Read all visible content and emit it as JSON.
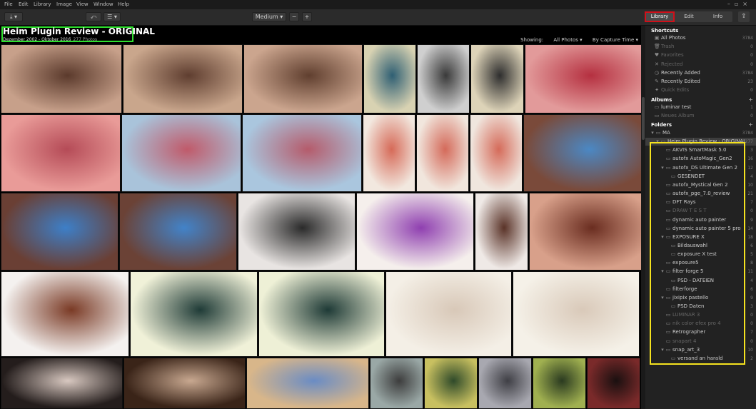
{
  "menu": [
    "File",
    "Edit",
    "Library",
    "Image",
    "View",
    "Window",
    "Help"
  ],
  "window_controls": [
    "–",
    "▫",
    "×"
  ],
  "toolbar": {
    "import_icon": "download-icon",
    "zoom_value": "Medium",
    "zoom_out": "−",
    "zoom_in": "+",
    "tabs": [
      "Library",
      "Edit",
      "Info"
    ],
    "active_tab": "Library",
    "share_icon": "share-icon"
  },
  "album": {
    "title": "Heim Plugin Review - ORIGINAL",
    "date_range": "Dezember 2002 - Oktober 2016",
    "photo_count": "277 Photos",
    "showing_label": "Showing:",
    "filter": "All Photos",
    "sort": "By Capture Time"
  },
  "thumbnails": [
    {
      "row": 0,
      "colors": [
        "#c7a08a",
        "#5b3a2c"
      ]
    },
    {
      "row": 0,
      "colors": [
        "#c9a68c",
        "#5f3e30"
      ]
    },
    {
      "row": 0,
      "colors": [
        "#cba58e",
        "#603f2f"
      ]
    },
    {
      "row": 0,
      "colors": [
        "#d8d2b2",
        "#2f5f73"
      ]
    },
    {
      "row": 0,
      "colors": [
        "#cfcfcf",
        "#3a3a3a"
      ]
    },
    {
      "row": 0,
      "colors": [
        "#ddd3b8",
        "#2e2e2e"
      ]
    },
    {
      "row": 0,
      "colors": [
        "#e29a9a",
        "#b53040"
      ]
    },
    {
      "row": 1,
      "colors": [
        "#e99b98",
        "#b54b57"
      ]
    },
    {
      "row": 1,
      "colors": [
        "#a9c3da",
        "#c05a6a"
      ]
    },
    {
      "row": 1,
      "colors": [
        "#aac6de",
        "#b55b6b"
      ]
    },
    {
      "row": 1,
      "colors": [
        "#f2e8df",
        "#d66a58"
      ]
    },
    {
      "row": 1,
      "colors": [
        "#f1e6dd",
        "#d46a5a"
      ]
    },
    {
      "row": 1,
      "colors": [
        "#f0e6de",
        "#d56b5a"
      ]
    },
    {
      "row": 1,
      "colors": [
        "#7a4a3a",
        "#4b88c4"
      ]
    },
    {
      "row": 2,
      "colors": [
        "#6a3f34",
        "#3d7fc8"
      ]
    },
    {
      "row": 2,
      "colors": [
        "#6b4236",
        "#4283c9"
      ]
    },
    {
      "row": 2,
      "colors": [
        "#e8e4e2",
        "#2a2a2a"
      ]
    },
    {
      "row": 2,
      "colors": [
        "#f5efec",
        "#8f3fb0"
      ]
    },
    {
      "row": 2,
      "colors": [
        "#efe9e6",
        "#5a3328"
      ]
    },
    {
      "row": 2,
      "colors": [
        "#d8a08a",
        "#6a2d20"
      ]
    },
    {
      "row": 3,
      "colors": [
        "#f4f1ef",
        "#7a3a25"
      ]
    },
    {
      "row": 3,
      "colors": [
        "#f0f1d8",
        "#1f3b37"
      ]
    },
    {
      "row": 3,
      "colors": [
        "#eef0d6",
        "#1e3a36"
      ]
    },
    {
      "row": 3,
      "colors": [
        "#f4efe6",
        "#d8c8b8"
      ]
    },
    {
      "row": 3,
      "colors": [
        "#f5f1e8",
        "#d9c9b9"
      ]
    },
    {
      "row": 4,
      "colors": [
        "#241d1c",
        "#d8c8c0"
      ]
    },
    {
      "row": 4,
      "colors": [
        "#3a2418",
        "#c8a890"
      ]
    },
    {
      "row": 4,
      "colors": [
        "#d8b68a",
        "#6a8cc4"
      ]
    },
    {
      "row": 4,
      "colors": [
        "#9aa8a6",
        "#3d3d3d"
      ]
    },
    {
      "row": 4,
      "colors": [
        "#c8c060",
        "#2f4a2a"
      ]
    },
    {
      "row": 4,
      "colors": [
        "#a8a8b0",
        "#3f3f45"
      ]
    },
    {
      "row": 4,
      "colors": [
        "#a0b050",
        "#2a3a20"
      ]
    },
    {
      "row": 4,
      "colors": [
        "#7a2a2a",
        "#1a1010"
      ]
    }
  ],
  "sidebar": {
    "shortcuts_label": "Shortcuts",
    "shortcuts": [
      {
        "icon": "photos-icon",
        "label": "All Photos",
        "count": "3784",
        "dim": false
      },
      {
        "icon": "trash-icon",
        "label": "Trash",
        "count": "0",
        "dim": true
      },
      {
        "icon": "heart-icon",
        "label": "Favorites",
        "count": "0",
        "dim": true
      },
      {
        "icon": "close-icon",
        "label": "Rejected",
        "count": "0",
        "dim": true
      },
      {
        "icon": "clock-icon",
        "label": "Recently Added",
        "count": "3784",
        "dim": false
      },
      {
        "icon": "edit-icon",
        "label": "Recently Edited",
        "count": "23",
        "dim": false
      },
      {
        "icon": "quick-edit-icon",
        "label": "Quick Edits",
        "count": "0",
        "dim": true
      }
    ],
    "albums_label": "Albums",
    "albums": [
      {
        "icon": "album-icon",
        "label": "luminar test",
        "count": "1",
        "dim": false
      },
      {
        "icon": "album-icon",
        "label": "Neues Album",
        "count": "0",
        "dim": true
      }
    ],
    "folders_label": "Folders",
    "folders": [
      {
        "indent": 0,
        "arrow": "▾",
        "label": "MA",
        "count": "3784",
        "dim": false,
        "sel": false
      },
      {
        "indent": 1,
        "arrow": "▾",
        "label": "Heim Plugin Review - ORIGINAL",
        "count": "277",
        "dim": false,
        "sel": true
      },
      {
        "indent": 2,
        "arrow": "",
        "label": "AKVIS SmartMask 5.0",
        "count": "3",
        "dim": false,
        "sel": false
      },
      {
        "indent": 2,
        "arrow": "",
        "label": "autofx AutoMagic_Gen2",
        "count": "16",
        "dim": false,
        "sel": false
      },
      {
        "indent": 2,
        "arrow": "▾",
        "label": "autofx_DS Ultimate Gen 2",
        "count": "12",
        "dim": false,
        "sel": false
      },
      {
        "indent": 3,
        "arrow": "",
        "label": "GESENDET",
        "count": "4",
        "dim": false,
        "sel": false
      },
      {
        "indent": 2,
        "arrow": "",
        "label": "autofx_Mystical Gen 2",
        "count": "10",
        "dim": false,
        "sel": false
      },
      {
        "indent": 2,
        "arrow": "",
        "label": "autofx_pge_7.0_review",
        "count": "21",
        "dim": false,
        "sel": false
      },
      {
        "indent": 2,
        "arrow": "",
        "label": "DFT Rays",
        "count": "7",
        "dim": false,
        "sel": false
      },
      {
        "indent": 2,
        "arrow": "",
        "label": "DRAW T E S T",
        "count": "0",
        "dim": true,
        "sel": false
      },
      {
        "indent": 2,
        "arrow": "",
        "label": "dynamic auto painter",
        "count": "9",
        "dim": false,
        "sel": false
      },
      {
        "indent": 2,
        "arrow": "",
        "label": "dynamic auto painter 5 pro",
        "count": "14",
        "dim": false,
        "sel": false
      },
      {
        "indent": 2,
        "arrow": "▾",
        "label": "EXPOSURE  X",
        "count": "18",
        "dim": false,
        "sel": false
      },
      {
        "indent": 3,
        "arrow": "",
        "label": "Bildauswahl",
        "count": "6",
        "dim": false,
        "sel": false
      },
      {
        "indent": 3,
        "arrow": "",
        "label": "exposure X test",
        "count": "5",
        "dim": false,
        "sel": false
      },
      {
        "indent": 2,
        "arrow": "",
        "label": "exposure5",
        "count": "8",
        "dim": false,
        "sel": false
      },
      {
        "indent": 2,
        "arrow": "▾",
        "label": "filter forge 5",
        "count": "11",
        "dim": false,
        "sel": false
      },
      {
        "indent": 3,
        "arrow": "",
        "label": "PSD - DATEIEN",
        "count": "4",
        "dim": false,
        "sel": false
      },
      {
        "indent": 2,
        "arrow": "",
        "label": "filterforge",
        "count": "6",
        "dim": false,
        "sel": false
      },
      {
        "indent": 2,
        "arrow": "▾",
        "label": "jixipix pastello",
        "count": "9",
        "dim": false,
        "sel": false
      },
      {
        "indent": 3,
        "arrow": "",
        "label": "PSD Daten",
        "count": "3",
        "dim": false,
        "sel": false
      },
      {
        "indent": 2,
        "arrow": "",
        "label": "LUMINAR 3",
        "count": "0",
        "dim": true,
        "sel": false
      },
      {
        "indent": 2,
        "arrow": "",
        "label": "nik color efex pro 4",
        "count": "0",
        "dim": true,
        "sel": false
      },
      {
        "indent": 2,
        "arrow": "",
        "label": "Retrographer",
        "count": "7",
        "dim": false,
        "sel": false
      },
      {
        "indent": 2,
        "arrow": "",
        "label": "snapart 4",
        "count": "0",
        "dim": true,
        "sel": false
      },
      {
        "indent": 2,
        "arrow": "▾",
        "label": "snap_art_3",
        "count": "10",
        "dim": false,
        "sel": false
      },
      {
        "indent": 3,
        "arrow": "",
        "label": "versand an harald",
        "count": "2",
        "dim": false,
        "sel": false
      }
    ]
  }
}
